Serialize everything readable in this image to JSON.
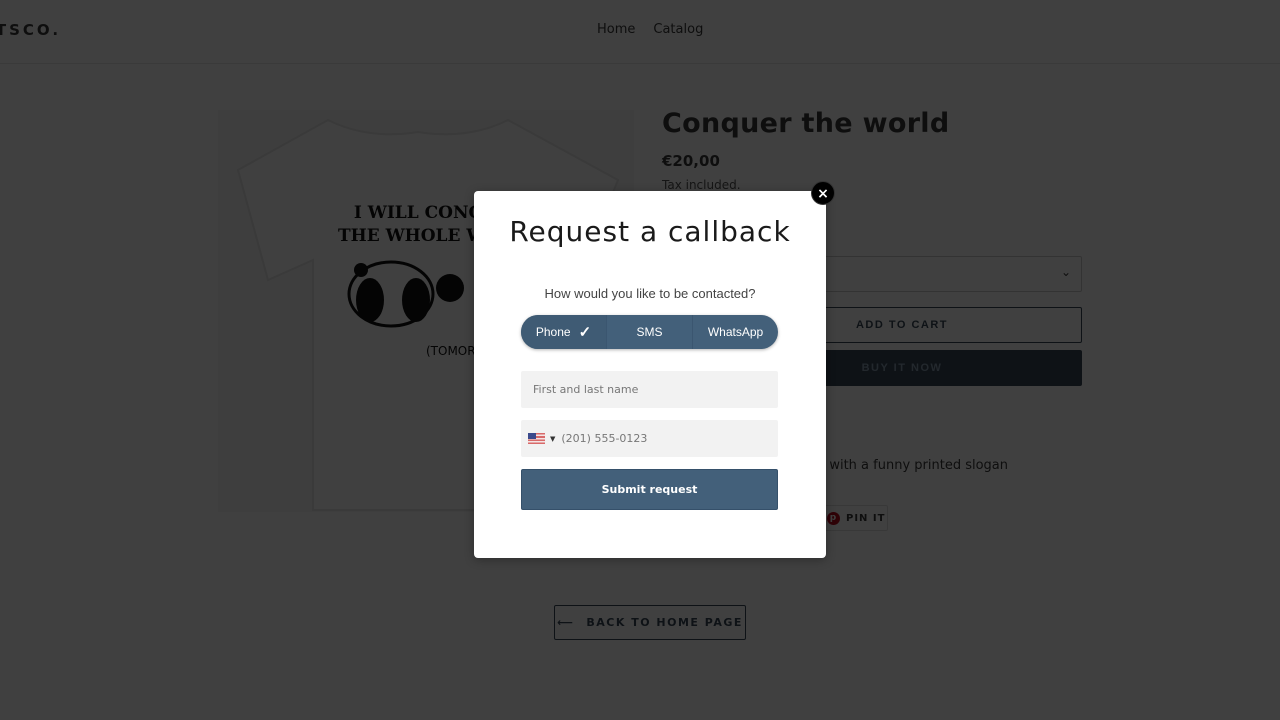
{
  "header": {
    "logo": "RTSCO.",
    "nav": [
      "Home",
      "Catalog"
    ]
  },
  "product": {
    "image_slogan_line1": "I WILL CONQUER",
    "image_slogan_line2": "THE WHOLE WORLD",
    "image_caption": "(TOMORROW)",
    "title": "Conquer the world",
    "price": "€20,00",
    "tax_note": "Tax included.",
    "add_to_cart": "ADD TO CART",
    "buy_now": "BUY IT NOW",
    "description": "t with a funny printed slogan",
    "pin_label": "PIN IT",
    "back_label": "BACK TO HOME PAGE",
    "back_arrow": "⟵"
  },
  "modal": {
    "close_icon": "×",
    "title": "Request a callback",
    "question": "How would you like to be contacted?",
    "options": [
      {
        "label": "Phone",
        "selected": true,
        "check": "✓"
      },
      {
        "label": "SMS",
        "selected": false
      },
      {
        "label": "WhatsApp",
        "selected": false
      }
    ],
    "name_placeholder": "First and last name",
    "phone_placeholder": "(201) 555-0123",
    "country_caret": "▼",
    "submit_label": "Submit request"
  },
  "colors": {
    "accent": "#43607a",
    "overlay": "rgba(0,0,0,0.75)"
  }
}
